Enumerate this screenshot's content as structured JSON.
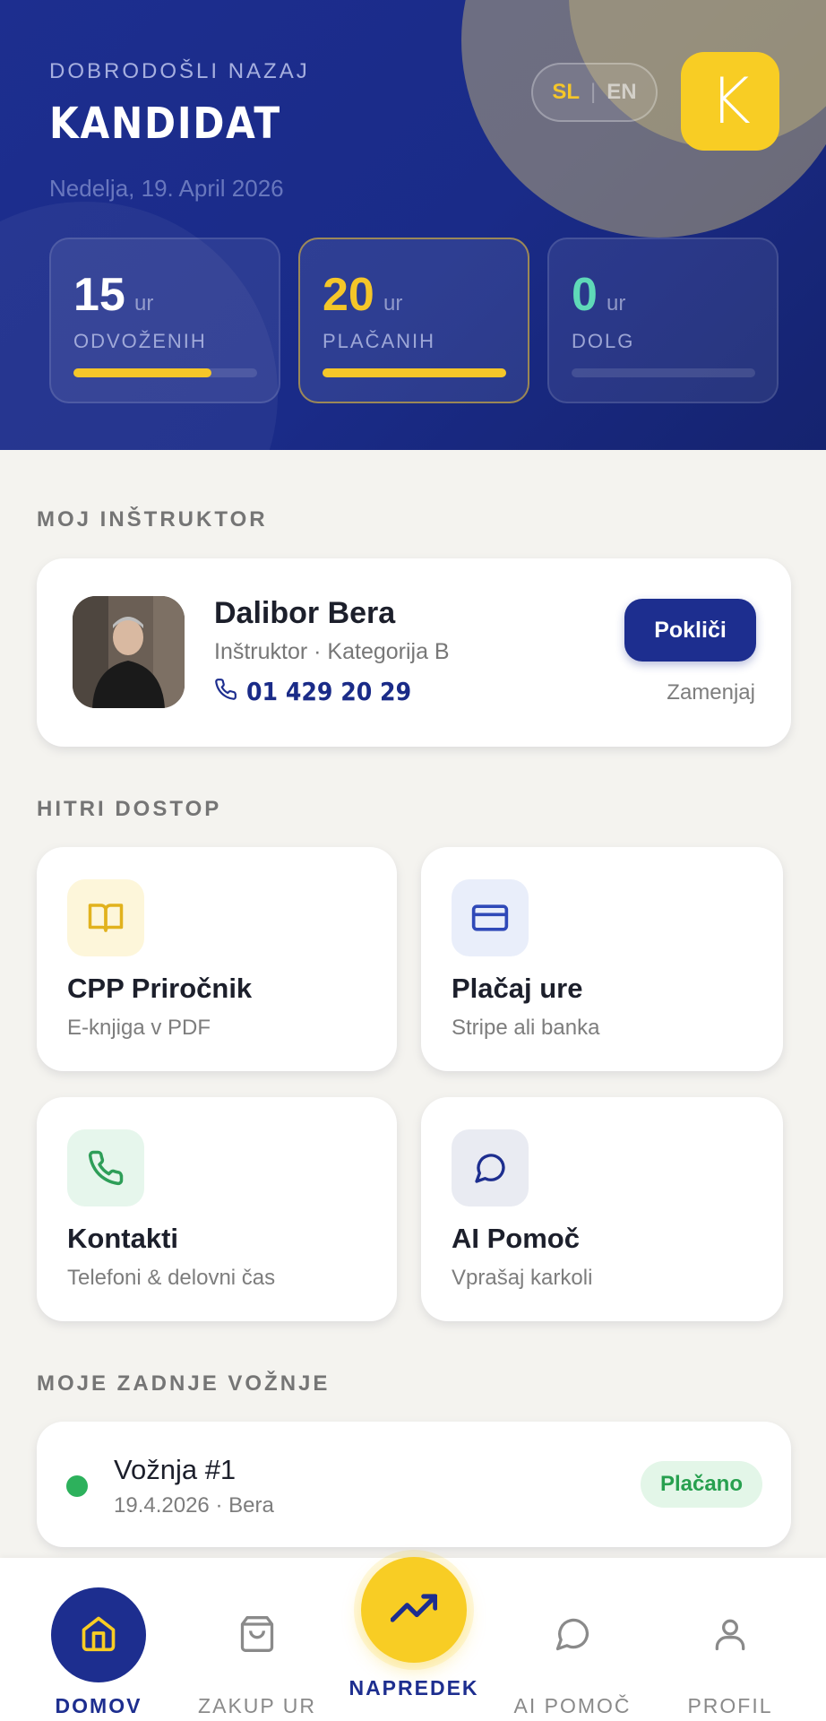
{
  "header": {
    "welcome": "DOBRODOŠLI NAZAJ",
    "name": "KANDIDAT",
    "date": "Nedelja, 19. April 2026",
    "lang_sl": "SL",
    "lang_sep": "|",
    "lang_en": "EN",
    "avatar_letter": "K"
  },
  "stats": [
    {
      "value": "15",
      "unit": "ur",
      "label": "ODVOŽENIH",
      "progress": 0.75,
      "value_color": "#ffffff"
    },
    {
      "value": "20",
      "unit": "ur",
      "label": "PLAČANIH",
      "progress": 1.0,
      "value_color": "#f5c629"
    },
    {
      "value": "0",
      "unit": "ur",
      "label": "DOLG",
      "progress": 0.0,
      "value_color": "#5fd9b8"
    }
  ],
  "instructor_section": {
    "title": "MOJ INŠTRUKTOR",
    "name": "Dalibor Bera",
    "role": "Inštruktor · Kategorija B",
    "phone": "01 429 20 29",
    "call_label": "Pokliči",
    "swap_label": "Zamenjaj"
  },
  "quick_access": {
    "title": "HITRI DOSTOP",
    "items": [
      {
        "title": "CPP Priročnik",
        "subtitle": "E-knjiga v PDF",
        "icon": "book-icon",
        "icon_bg": "#fdf6da",
        "icon_color": "#e1b21d"
      },
      {
        "title": "Plačaj ure",
        "subtitle": "Stripe ali banka",
        "icon": "credit-card-icon",
        "icon_bg": "#e9eefa",
        "icon_color": "#2f49b8"
      },
      {
        "title": "Kontakti",
        "subtitle": "Telefoni & delovni čas",
        "icon": "phone-icon",
        "icon_bg": "#e6f6ec",
        "icon_color": "#2e9e58"
      },
      {
        "title": "AI Pomoč",
        "subtitle": "Vprašaj karkoli",
        "icon": "chat-icon",
        "icon_bg": "#e9ebf2",
        "icon_color": "#1d2e8f"
      }
    ]
  },
  "rides": {
    "title": "MOJE ZADNJE VOŽNJE",
    "items": [
      {
        "title": "Vožnja #1",
        "subtitle": "19.4.2026 · Bera",
        "status": "Plačano"
      }
    ]
  },
  "nav": {
    "items": [
      {
        "label": "DOMOV",
        "icon": "home-icon",
        "active": true
      },
      {
        "label": "ZAKUP UR",
        "icon": "shopping-bag-icon",
        "active": false
      },
      {
        "label": "NAPREDEK",
        "icon": "trending-up-icon",
        "active": false
      },
      {
        "label": "AI POMOČ",
        "icon": "chat-icon",
        "active": false
      },
      {
        "label": "PROFIL",
        "icon": "user-icon",
        "active": false
      }
    ]
  },
  "colors": {
    "primary": "#1d2e8f",
    "accent": "#f8cd24",
    "success": "#2db15c"
  }
}
